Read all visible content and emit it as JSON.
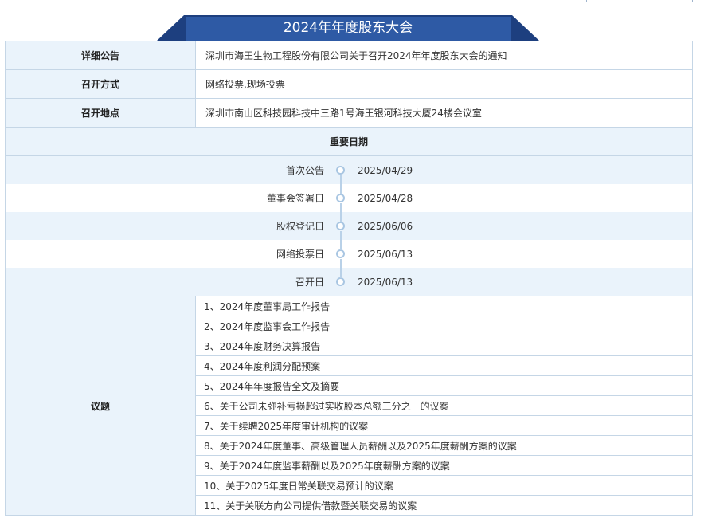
{
  "banner": {
    "title": "2024年年度股东大会"
  },
  "info_rows": [
    {
      "label": "详细公告",
      "value": "深圳市海王生物工程股份有限公司关于召开2024年年度股东大会的通知"
    },
    {
      "label": "召开方式",
      "value": "网络投票,现场投票"
    },
    {
      "label": "召开地点",
      "value": "深圳市南山区科技园科技中三路1号海王银河科技大厦24楼会议室"
    }
  ],
  "dates": {
    "header": "重要日期",
    "items": [
      {
        "label": "首次公告",
        "date": "2025/04/29"
      },
      {
        "label": "董事会签署日",
        "date": "2025/04/28"
      },
      {
        "label": "股权登记日",
        "date": "2025/06/06"
      },
      {
        "label": "网络投票日",
        "date": "2025/06/13"
      },
      {
        "label": "召开日",
        "date": "2025/06/13"
      }
    ]
  },
  "agenda": {
    "label": "议题",
    "items": [
      "1、2024年度董事局工作报告",
      "2、2024年度监事会工作报告",
      "3、2024年度财务决算报告",
      "4、2024年度利润分配预案",
      "5、2024年年度报告全文及摘要",
      "6、关于公司未弥补亏损超过实收股本总额三分之一的议案",
      "7、关于续聘2025年度审计机构的议案",
      "8、关于2024年度董事、高级管理人员薪酬以及2025年度薪酬方案的议案",
      "9、关于2024年度监事薪酬以及2025年度薪酬方案的议案",
      "10、关于2025年度日常关联交易预计的议案",
      "11、关于关联方向公司提供借款暨关联交易的议案"
    ]
  },
  "colors": {
    "banner_dark": "#1d3f7f",
    "banner_light": "#2e5aa5",
    "label_bg": "#eaf3fb",
    "border": "#c5d6e6"
  }
}
